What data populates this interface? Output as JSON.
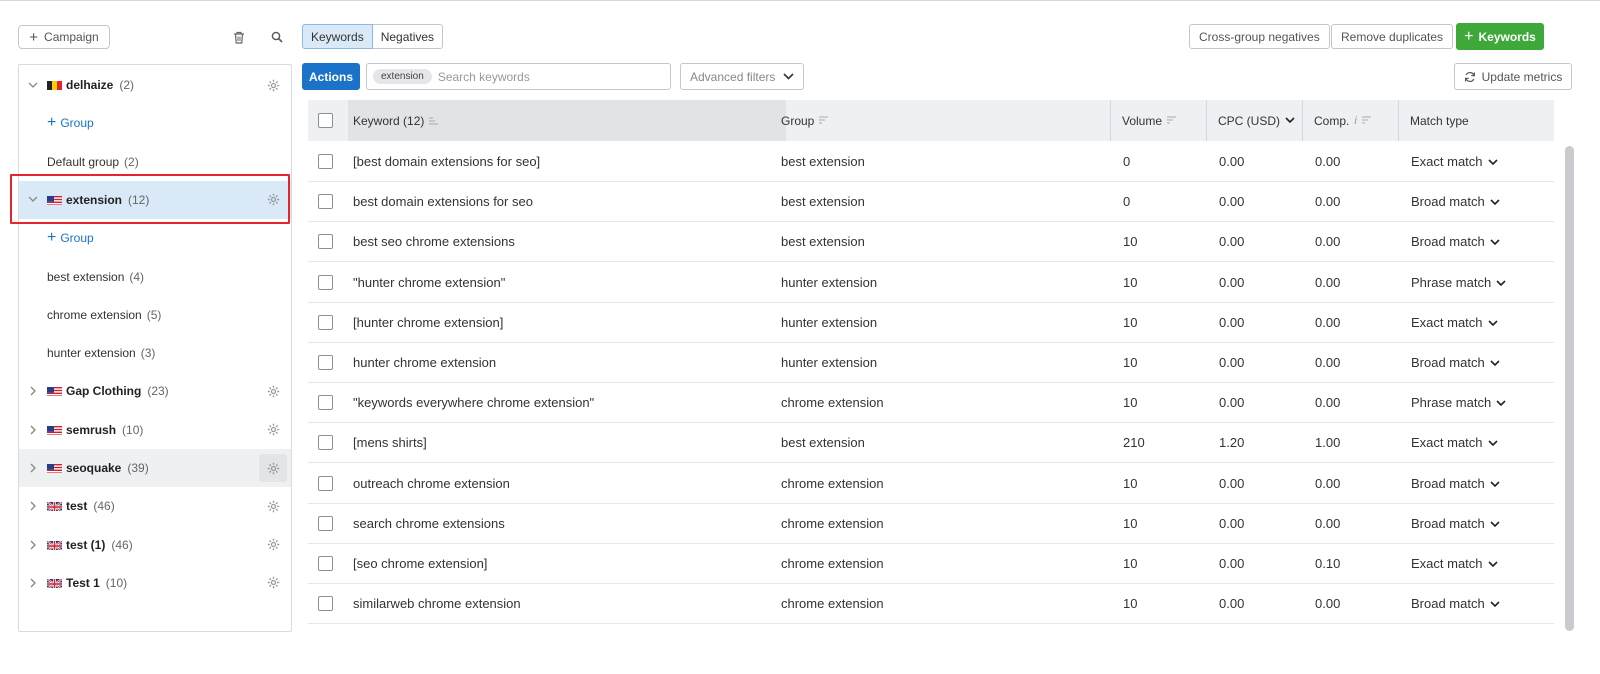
{
  "toolbar": {
    "campaign_label": "Campaign",
    "tab_keywords": "Keywords",
    "tab_negatives": "Negatives",
    "cross_group_label": "Cross-group negatives",
    "remove_duplicates_label": "Remove duplicates",
    "add_keywords_label": "Keywords",
    "actions_label": "Actions",
    "search_chip": "extension",
    "search_placeholder": "Search keywords",
    "advanced_filters_label": "Advanced filters",
    "update_metrics_label": "Update metrics"
  },
  "sidebar": {
    "add_group_label": "Group",
    "campaigns": [
      {
        "name": "delhaize",
        "count": "(2)",
        "flag": "be",
        "expanded": true
      },
      {
        "name": "extension",
        "count": "(12)",
        "flag": "us",
        "expanded": true,
        "selected": true
      },
      {
        "name": "Gap Clothing",
        "count": "(23)",
        "flag": "us"
      },
      {
        "name": "semrush",
        "count": "(10)",
        "flag": "us"
      },
      {
        "name": "seoquake",
        "count": "(39)",
        "flag": "us",
        "hover": true
      },
      {
        "name": "test",
        "count": "(46)",
        "flag": "uk"
      },
      {
        "name": "test (1)",
        "count": "(46)",
        "flag": "uk"
      },
      {
        "name": "Test 1",
        "count": "(10)",
        "flag": "uk"
      }
    ],
    "delhaize_groups": [
      {
        "name": "Default group",
        "count": "(2)"
      }
    ],
    "extension_groups": [
      {
        "name": "best extension",
        "count": "(4)"
      },
      {
        "name": "chrome extension",
        "count": "(5)"
      },
      {
        "name": "hunter extension",
        "count": "(3)"
      }
    ]
  },
  "table": {
    "headers": {
      "keyword": "Keyword (12)",
      "group": "Group",
      "volume": "Volume",
      "cpc": "CPC (USD)",
      "comp": "Comp.",
      "match": "Match type"
    },
    "rows": [
      {
        "keyword": "[best domain extensions for seo]",
        "group": "best extension",
        "volume": "0",
        "cpc": "0.00",
        "comp": "0.00",
        "match": "Exact match"
      },
      {
        "keyword": "best domain extensions for seo",
        "group": "best extension",
        "volume": "0",
        "cpc": "0.00",
        "comp": "0.00",
        "match": "Broad match"
      },
      {
        "keyword": "best seo chrome extensions",
        "group": "best extension",
        "volume": "10",
        "cpc": "0.00",
        "comp": "0.00",
        "match": "Broad match"
      },
      {
        "keyword": "\"hunter chrome extension\"",
        "group": "hunter extension",
        "volume": "10",
        "cpc": "0.00",
        "comp": "0.00",
        "match": "Phrase match"
      },
      {
        "keyword": "[hunter chrome extension]",
        "group": "hunter extension",
        "volume": "10",
        "cpc": "0.00",
        "comp": "0.00",
        "match": "Exact match"
      },
      {
        "keyword": "hunter chrome extension",
        "group": "hunter extension",
        "volume": "10",
        "cpc": "0.00",
        "comp": "0.00",
        "match": "Broad match"
      },
      {
        "keyword": "\"keywords everywhere chrome extension\"",
        "group": "chrome extension",
        "volume": "10",
        "cpc": "0.00",
        "comp": "0.00",
        "match": "Phrase match"
      },
      {
        "keyword": "[mens shirts]",
        "group": "best extension",
        "volume": "210",
        "cpc": "1.20",
        "comp": "1.00",
        "match": "Exact match"
      },
      {
        "keyword": "outreach chrome extension",
        "group": "chrome extension",
        "volume": "10",
        "cpc": "0.00",
        "comp": "0.00",
        "match": "Broad match"
      },
      {
        "keyword": "search chrome extensions",
        "group": "chrome extension",
        "volume": "10",
        "cpc": "0.00",
        "comp": "0.00",
        "match": "Broad match"
      },
      {
        "keyword": "[seo chrome extension]",
        "group": "chrome extension",
        "volume": "10",
        "cpc": "0.00",
        "comp": "0.10",
        "match": "Exact match"
      },
      {
        "keyword": "similarweb chrome extension",
        "group": "chrome extension",
        "volume": "10",
        "cpc": "0.00",
        "comp": "0.00",
        "match": "Broad match"
      }
    ]
  },
  "colors": {
    "accent_blue": "#1a73c8",
    "add_green": "#3fa83b",
    "selected_row": "#d9e9f7",
    "highlight_red": "#e3262a"
  }
}
